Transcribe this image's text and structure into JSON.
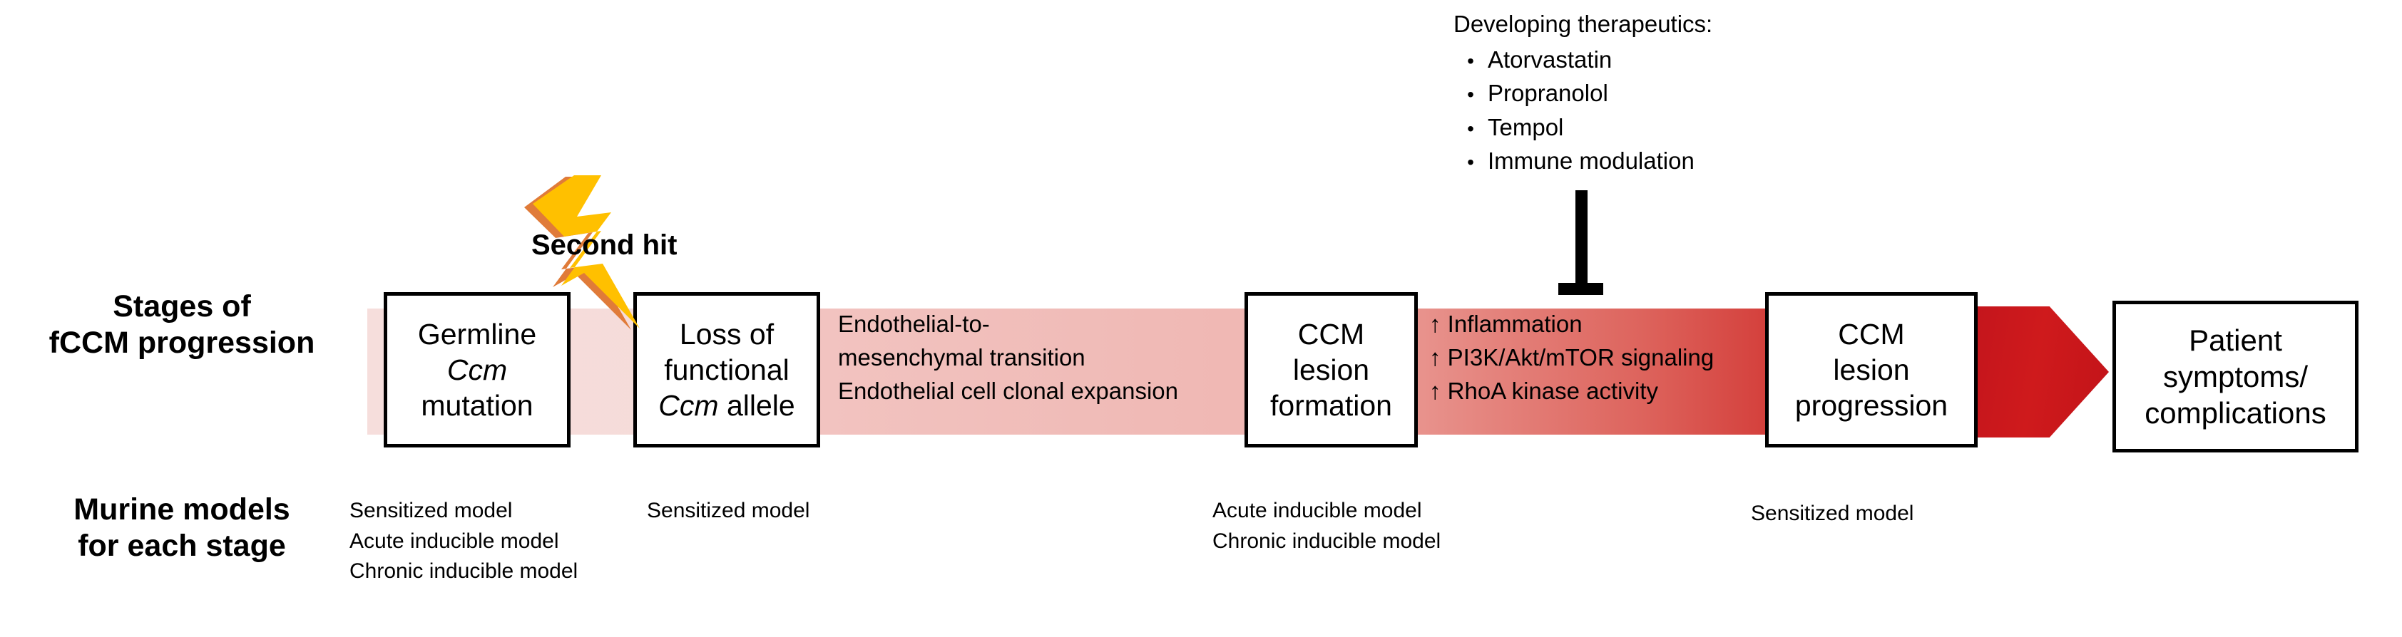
{
  "row_labels": {
    "stages": "Stages of\nfCCM progression",
    "murine": "Murine models\nfor each stage"
  },
  "stages": [
    {
      "id": "germline-ccm-mutation",
      "lines": [
        "Germline",
        "Ccm",
        "mutation"
      ],
      "italic_lines": [
        1
      ]
    },
    {
      "id": "loss-of-functional-ccm-allele",
      "lines": [
        "Loss of",
        "functional",
        "Ccm allele"
      ],
      "italic_lines": []
    },
    {
      "id": "ccm-lesion-formation",
      "lines": [
        "CCM",
        "lesion",
        "formation"
      ],
      "italic_lines": []
    },
    {
      "id": "ccm-lesion-progression",
      "lines": [
        "CCM",
        "lesion",
        "progression"
      ],
      "italic_lines": []
    },
    {
      "id": "patient-symptoms-complications",
      "lines": [
        "Patient",
        "symptoms/",
        "complications"
      ],
      "italic_lines": []
    }
  ],
  "annotations": {
    "second_hit": "Second hit",
    "emt_text": "Endothelial-to-\nmesenchymal transition\nEndothelial cell clonal expansion",
    "pathway_text": "↑ Inflammation\n↑ PI3K/Akt/mTOR signaling\n↑ RhoA kinase activity"
  },
  "therapeutics": {
    "heading": "Developing therapeutics:",
    "bullet_glyph": "•",
    "items": [
      "Atorvastatin",
      "Propranolol",
      "Tempol",
      "Immune modulation"
    ]
  },
  "murine_models": {
    "stage_1": "Sensitized model\nAcute inducible model\nChronic inducible model",
    "stage_2": "Sensitized model",
    "stage_3": "Acute inducible model\nChronic inducible model",
    "stage_4": "Sensitized model"
  },
  "colors": {
    "band_light": "#f6dedc",
    "band_mid": "#f0bab6",
    "band_dark": "#d4403c",
    "arrow_red": "#c8171d",
    "bolt_fill": "#FFC000",
    "bolt_shadow": "#E07B39",
    "outline": "#000000"
  }
}
